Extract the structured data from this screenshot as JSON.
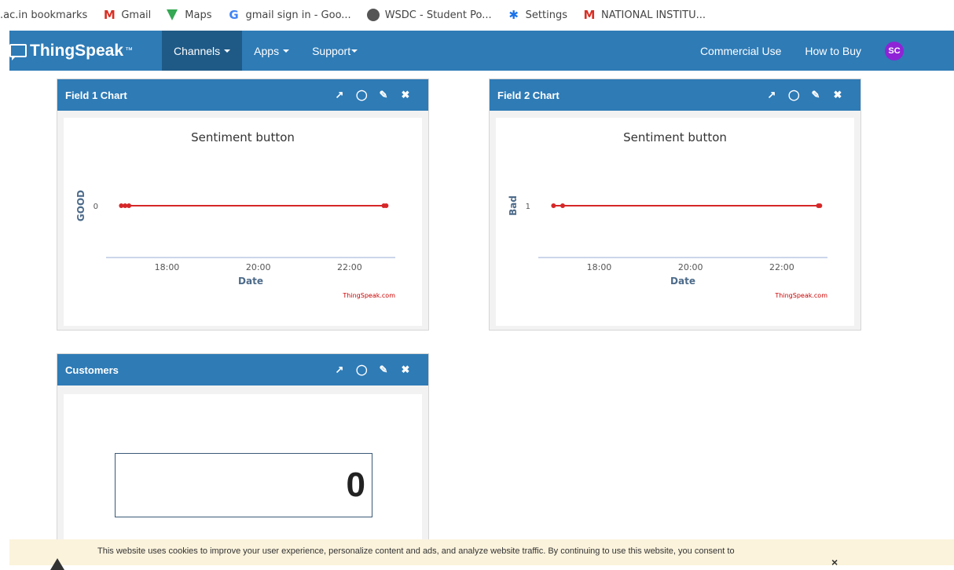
{
  "bookmarks": [
    {
      "label": ".ac.in bookmarks",
      "icon": "none"
    },
    {
      "label": "Gmail",
      "icon": "gmail-icon"
    },
    {
      "label": "Maps",
      "icon": "maps-icon"
    },
    {
      "label": "gmail sign in - Goo...",
      "icon": "google-icon"
    },
    {
      "label": "WSDC - Student Po...",
      "icon": "globe-icon"
    },
    {
      "label": "Settings",
      "icon": "gear-icon"
    },
    {
      "label": "NATIONAL INSTITU...",
      "icon": "gmail-icon"
    }
  ],
  "navbar": {
    "brand": "ThingSpeak",
    "brand_tm": "™",
    "channels": "Channels",
    "apps": "Apps",
    "support": "Support",
    "commercial": "Commercial Use",
    "how_to_buy": "How to Buy",
    "avatar": "SC",
    "color": "#2e7bb6",
    "active_color": "#1f5a87"
  },
  "widgets": {
    "field1": {
      "title": "Field 1 Chart"
    },
    "field2": {
      "title": "Field 2 Chart"
    },
    "customers": {
      "title": "Customers",
      "value": "0"
    }
  },
  "tool_icons": [
    "external-link-icon",
    "comment-icon",
    "pencil-icon",
    "close-icon"
  ],
  "chart_data": [
    {
      "type": "line",
      "title": "Sentiment button",
      "xlabel": "Date",
      "ylabel": "GOOD",
      "credit": "ThingSpeak.com",
      "x_ticks": [
        "18:00",
        "20:00",
        "22:00"
      ],
      "y_ticks": [
        "0"
      ],
      "series": [
        {
          "color": "#d62728",
          "x": [
            "17:00",
            "17:05",
            "17:10",
            "22:45",
            "22:48"
          ],
          "y": [
            0,
            0,
            0,
            0,
            0
          ]
        }
      ]
    },
    {
      "type": "line",
      "title": "Sentiment button",
      "xlabel": "Date",
      "ylabel": "Bad",
      "credit": "ThingSpeak.com",
      "x_ticks": [
        "18:00",
        "20:00",
        "22:00"
      ],
      "y_ticks": [
        "1"
      ],
      "series": [
        {
          "color": "#d62728",
          "x": [
            "17:00",
            "17:12",
            "22:48",
            "22:50"
          ],
          "y": [
            1,
            1,
            1,
            1
          ]
        }
      ]
    }
  ],
  "cookie": {
    "text": "This website uses cookies to improve your user experience, personalize content and ads, and analyze website traffic. By continuing to use this website, you consent to",
    "close": "×",
    "bg": "#fbf3dc"
  }
}
